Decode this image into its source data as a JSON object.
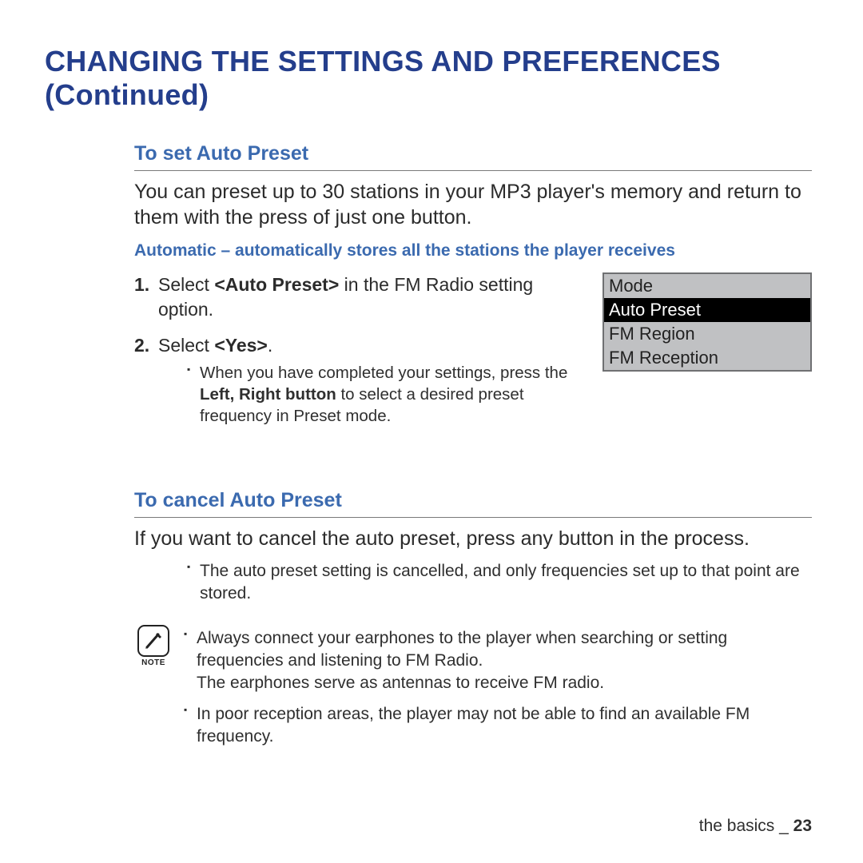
{
  "page_title": "CHANGING THE SETTINGS AND PREFERENCES (Continued)",
  "section1": {
    "title": "To set Auto Preset",
    "intro": "You can preset up to 30 stations in your MP3 player's memory and return to them with the press of just one button.",
    "sub_blue": "Automatic – automatically stores all the stations the player receives",
    "step1_a": "Select ",
    "step1_b": "<Auto Preset>",
    "step1_c": " in the FM Radio setting option.",
    "step2_a": "Select ",
    "step2_b": "<Yes>",
    "step2_c": ".",
    "step2_bullet_a": "When you have completed your settings, press the ",
    "step2_bullet_b": "Left, Right button",
    "step2_bullet_c": " to select a desired preset frequency in Preset mode."
  },
  "menu": {
    "item0": "Mode",
    "item1": "Auto Preset",
    "item2": "FM Region",
    "item3": "FM Reception"
  },
  "section2": {
    "title": "To cancel Auto Preset",
    "body": "If you want to cancel the auto preset, press any button in the process.",
    "bullet": "The auto preset setting is cancelled, and only frequencies set up to that point are stored."
  },
  "note": {
    "label": "NOTE",
    "li1a": "Always connect your earphones to the player when searching or setting frequencies and listening to FM Radio.",
    "li1b": "The earphones serve as antennas to receive FM radio.",
    "li2": "In poor reception areas, the player may not be able to find an available FM frequency."
  },
  "footer": {
    "section": "the basics _ ",
    "page": "23"
  }
}
